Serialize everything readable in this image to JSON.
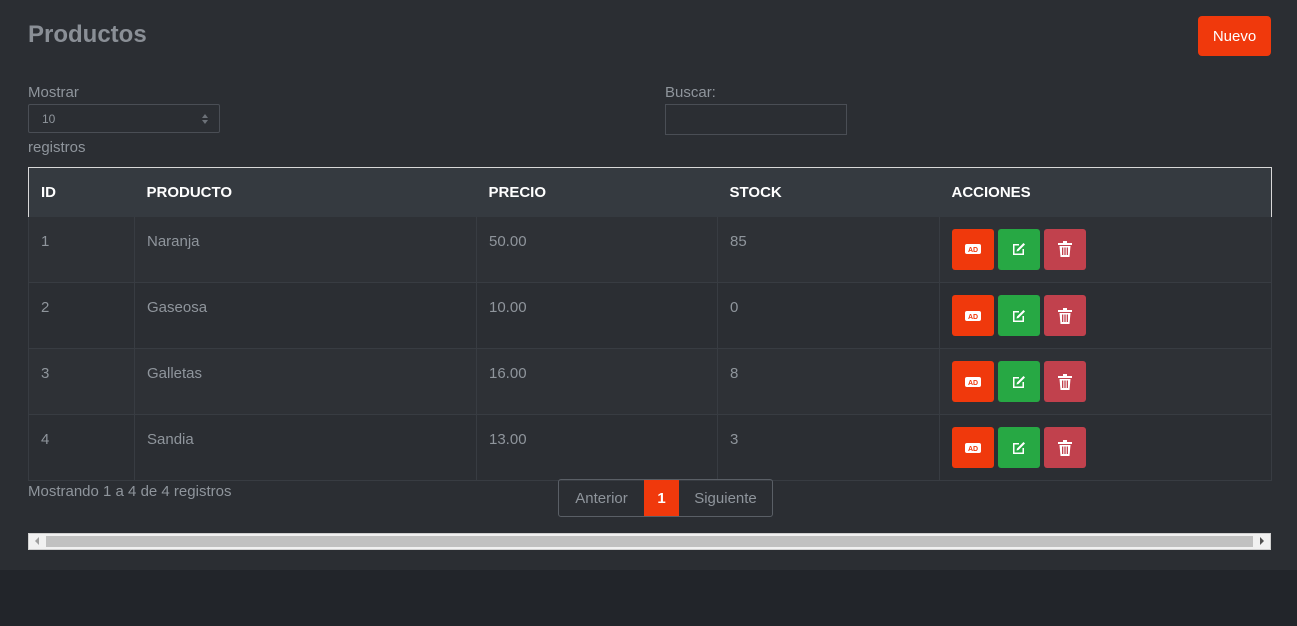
{
  "header": {
    "title": "Productos",
    "new_button": "Nuevo"
  },
  "controls": {
    "show_label": "Mostrar",
    "page_size": "10",
    "records_label": "registros",
    "search_label": "Buscar:",
    "search_value": ""
  },
  "table": {
    "columns": [
      "ID",
      "PRODUCTO",
      "PRECIO",
      "STOCK",
      "ACCIONES"
    ],
    "rows": [
      {
        "id": "1",
        "product": "Naranja",
        "price": "50.00",
        "stock": "85"
      },
      {
        "id": "2",
        "product": "Gaseosa",
        "price": "10.00",
        "stock": "0"
      },
      {
        "id": "3",
        "product": "Galletas",
        "price": "16.00",
        "stock": "8"
      },
      {
        "id": "4",
        "product": "Sandia",
        "price": "13.00",
        "stock": "3"
      }
    ],
    "action_icons": [
      "ad-icon",
      "edit-icon",
      "trash-icon"
    ]
  },
  "footer": {
    "info": "Mostrando 1 a 4 de 4 registros",
    "prev": "Anterior",
    "current_page": "1",
    "next": "Siguiente"
  },
  "colors": {
    "accent": "#f0390c",
    "edit": "#27a844",
    "delete": "#c1414d",
    "background": "#2b2e33"
  }
}
